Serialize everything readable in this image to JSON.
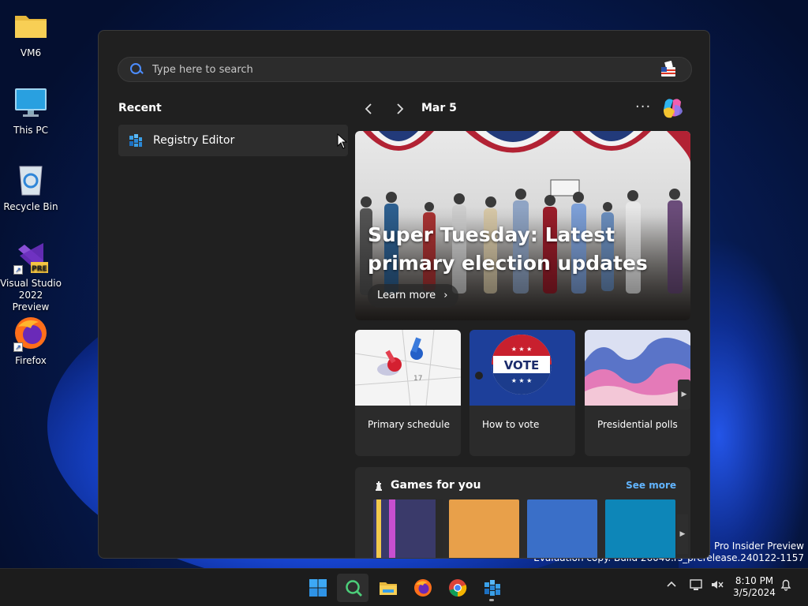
{
  "desktop": {
    "icons": [
      {
        "label": "VM6",
        "icon": "folder-icon"
      },
      {
        "label": "This PC",
        "icon": "monitor-icon"
      },
      {
        "label": "Recycle Bin",
        "icon": "recycle-bin-icon"
      },
      {
        "label": "Visual Studio 2022 Preview",
        "icon": "visual-studio-icon",
        "badge": "PRE"
      },
      {
        "label": "Firefox",
        "icon": "firefox-icon"
      }
    ],
    "watermark": {
      "line1": "s 11 Pro Insider Preview",
      "line2": "Evaluation copy. Build 26040.rs_prerelease.240122-1157"
    }
  },
  "start": {
    "search": {
      "placeholder": "Type here to search"
    },
    "recent": {
      "title": "Recent",
      "items": [
        {
          "label": "Registry Editor",
          "icon": "registry-editor-icon"
        }
      ]
    },
    "feed": {
      "date": "Mar 5",
      "hero": {
        "title": "Super Tuesday: Latest primary election updates",
        "button": "Learn more"
      },
      "cards": [
        {
          "label": "Primary schedule"
        },
        {
          "label": "How to vote",
          "badge_text": "VOTE"
        },
        {
          "label": "Presidential polls"
        }
      ],
      "games": {
        "title": "Games for you",
        "see_more": "See more",
        "tiles": [
          "#3a3a6a",
          "#e8a04a",
          "#3a6fc8",
          "#0d86b8"
        ]
      }
    }
  },
  "taskbar": {
    "apps": [
      {
        "name": "start-button"
      },
      {
        "name": "search-taskbar-button"
      },
      {
        "name": "file-explorer-button"
      },
      {
        "name": "firefox-taskbar-button"
      },
      {
        "name": "chrome-taskbar-button"
      },
      {
        "name": "registry-editor-taskbar-button"
      }
    ],
    "tray": {
      "time": "8:10 PM",
      "date": "3/5/2024"
    }
  },
  "colors": {
    "accent": "#4c8dff",
    "link": "#62b5ff",
    "panel_bg": "#202020"
  }
}
